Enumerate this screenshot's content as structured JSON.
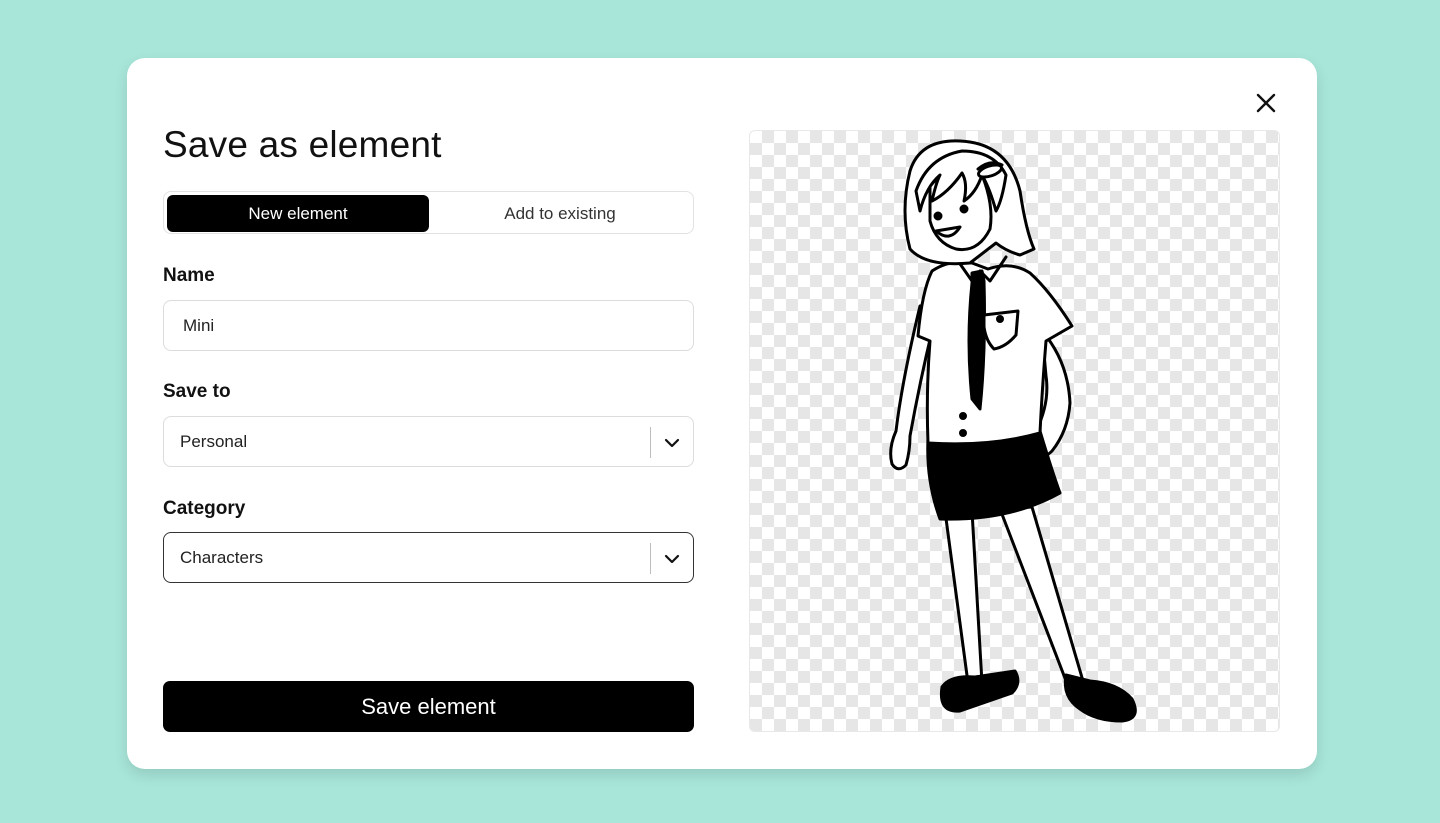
{
  "modal": {
    "title": "Save as element",
    "close_icon": "close-icon"
  },
  "tabs": [
    {
      "label": "New element",
      "active": true
    },
    {
      "label": "Add to existing",
      "active": false
    }
  ],
  "name_field": {
    "label": "Name",
    "value": "Mini"
  },
  "save_to_field": {
    "label": "Save to",
    "value": "Personal",
    "icon": "chevron-down-icon"
  },
  "category_field": {
    "label": "Category",
    "value": "Characters",
    "icon": "chevron-down-icon"
  },
  "save_button": {
    "label": "Save element"
  },
  "preview": {
    "image": "schoolgirl-character-illustration",
    "background": "transparency-checkerboard"
  },
  "colors": {
    "page_background": "#a8e6da",
    "modal_background": "#ffffff",
    "primary": "#000000"
  }
}
